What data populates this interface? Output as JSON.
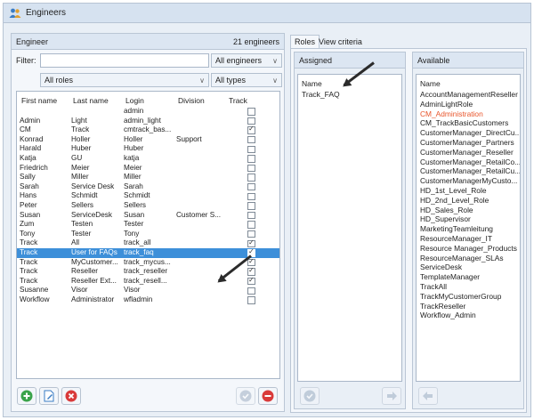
{
  "window": {
    "title": "Engineers"
  },
  "engineer_panel": {
    "title": "Engineer",
    "count": "21 engineers",
    "filter_label": "Filter:",
    "filter_value": "",
    "engineers_combo": "All engineers",
    "roles_combo": "All roles",
    "types_combo": "All types",
    "columns": [
      "First name",
      "Last name",
      "Login",
      "Division",
      "Track"
    ],
    "rows": [
      {
        "first": "",
        "last": "",
        "login": "admin",
        "division": "",
        "track": false
      },
      {
        "first": "Admin",
        "last": "Light",
        "login": "admin_light",
        "division": "",
        "track": false
      },
      {
        "first": "CM",
        "last": "Track",
        "login": "cmtrack_bas...",
        "division": "",
        "track": true
      },
      {
        "first": "Konrad",
        "last": "Holler",
        "login": "Holler",
        "division": "Support",
        "track": false
      },
      {
        "first": "Harald",
        "last": "Huber",
        "login": "Huber",
        "division": "",
        "track": false
      },
      {
        "first": "Katja",
        "last": "GU",
        "login": "katja",
        "division": "",
        "track": false
      },
      {
        "first": "Friedrich",
        "last": "Meier",
        "login": "Meier",
        "division": "",
        "track": false
      },
      {
        "first": "Sally",
        "last": "Miller",
        "login": "Miller",
        "division": "",
        "track": false
      },
      {
        "first": "Sarah",
        "last": "Service Desk",
        "login": "Sarah",
        "division": "",
        "track": false
      },
      {
        "first": "Hans",
        "last": "Schmidt",
        "login": "Schmidt",
        "division": "",
        "track": false
      },
      {
        "first": "Peter",
        "last": "Sellers",
        "login": "Sellers",
        "division": "",
        "track": false
      },
      {
        "first": "Susan",
        "last": "ServiceDesk",
        "login": "Susan",
        "division": "Customer S...",
        "track": false
      },
      {
        "first": "Zum",
        "last": "Testen",
        "login": "Tester",
        "division": "",
        "track": false
      },
      {
        "first": "Tony",
        "last": "Tester",
        "login": "Tony",
        "division": "",
        "track": false
      },
      {
        "first": "Track",
        "last": "All",
        "login": "track_all",
        "division": "",
        "track": true
      },
      {
        "first": "Track",
        "last": "User for FAQs",
        "login": "track_faq",
        "division": "",
        "track": true,
        "selected": true
      },
      {
        "first": "Track",
        "last": "MyCustomer...",
        "login": "track_mycus...",
        "division": "",
        "track": true
      },
      {
        "first": "Track",
        "last": "Reseller",
        "login": "track_reseller",
        "division": "",
        "track": true
      },
      {
        "first": "Track",
        "last": "Reseller Ext...",
        "login": "track_resell...",
        "division": "",
        "track": true
      },
      {
        "first": "Susanne",
        "last": "Visor",
        "login": "Visor",
        "division": "",
        "track": false
      },
      {
        "first": "Workflow",
        "last": "Administrator",
        "login": "wfladmin",
        "division": "",
        "track": false
      }
    ]
  },
  "tabs": {
    "roles": "Roles",
    "view_criteria": "View criteria"
  },
  "assigned_panel": {
    "title": "Assigned",
    "column": "Name",
    "items": [
      "Track_FAQ"
    ]
  },
  "available_panel": {
    "title": "Available",
    "column": "Name",
    "items": [
      "AccountManagementReseller",
      "AdminLightRole",
      "CM_Administration",
      "CM_TrackBasicCustomers",
      "CustomerManager_DirectCu...",
      "CustomerManager_Partners",
      "CustomerManager_Reseller",
      "CustomerManager_RetailCo...",
      "CustomerManager_RetailCu...",
      "CustomerManagerMyCusto...",
      "HD_1st_Level_Role",
      "HD_2nd_Level_Role",
      "HD_Sales_Role",
      "HD_Supervisor",
      "MarketingTeamleitung",
      "ResourceManager_IT",
      "Resource Manager_Products",
      "ResourceManager_SLAs",
      "ServiceDesk",
      "TemplateManager",
      "TrackAll",
      "TrackMyCustomerGroup",
      "TrackReseller",
      "Workflow_Admin"
    ],
    "highlight_item": "CM_Administration",
    "highlight_color": "#e8552b"
  },
  "colors": {
    "selection": "#3d8fd9",
    "header": "#dce6f2",
    "add": "#3aa34a",
    "delete": "#d93a3a"
  },
  "icons": {
    "title": "users-icon",
    "add": "add-icon",
    "edit": "edit-icon",
    "remove": "remove-icon",
    "check": "check-icon",
    "delete": "delete-icon",
    "arrow_left": "arrow-left-icon",
    "arrow_right": "arrow-right-icon"
  }
}
